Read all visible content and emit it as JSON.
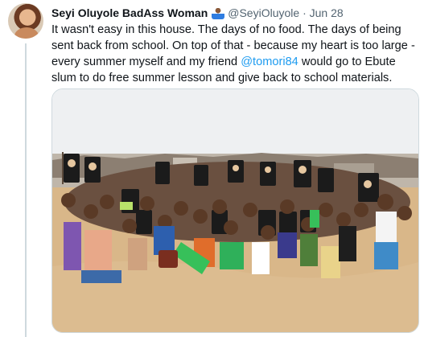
{
  "tweet": {
    "author_name": "Seyi Oluyole BadAss Woman",
    "author_emoji": "woman-teacher-emoji",
    "handle": "@SeyiOluyole",
    "separator": "·",
    "date": "Jun 28",
    "text_before": "It wasn't easy in this house. The days of no food. The days of being sent back from school. On top of that - because my heart is too large - every summer myself and my friend ",
    "mention": "@tomori84",
    "text_after": " would go to Ebute slum to do free summer lesson and give back to school materials.",
    "photo": {
      "subject": "group of children holding black school bags on sandy ground",
      "colors": {
        "sky": "#eef0f2",
        "sand": "#d9b789",
        "bags": "#141414",
        "accent_green": "#37c05a"
      }
    }
  }
}
